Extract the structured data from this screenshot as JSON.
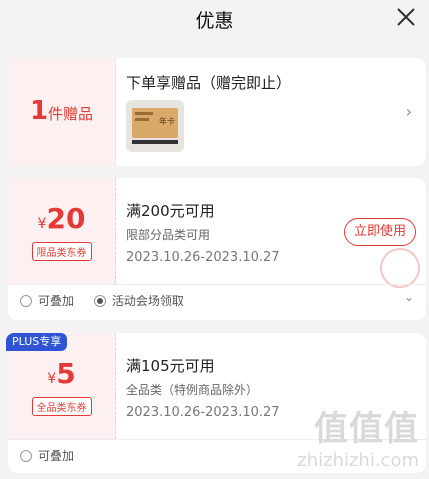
{
  "header": {
    "title": "优惠",
    "close_icon": "close-icon"
  },
  "gift": {
    "count": "1",
    "unit": "件赠品",
    "title": "下单享赠品（赠完即止）",
    "thumb_label": "年卡",
    "arrow": "›"
  },
  "coupons": [
    {
      "yen": "¥",
      "amount": "20",
      "tag": "限品类东券",
      "title": "满200元可用",
      "scope": "限部分品类可用",
      "date": "2023.10.26-2023.10.27",
      "button": "立即使用",
      "footer": [
        "可叠加",
        "活动会场领取"
      ],
      "expand": "⌄"
    },
    {
      "badge": "PLUS专享",
      "yen": "¥",
      "amount": "5",
      "tag": "全品类东券",
      "title": "满105元可用",
      "scope": "全品类（特例商品除外）",
      "date": "2023.10.26-2023.10.27",
      "footer": [
        "可叠加"
      ]
    }
  ],
  "watermark": {
    "big": "值值值",
    "small": "zhizhizhi.com"
  },
  "colors": {
    "accent": "#e53935",
    "plus": "#2f55d4",
    "background": "#f3f3f3"
  }
}
